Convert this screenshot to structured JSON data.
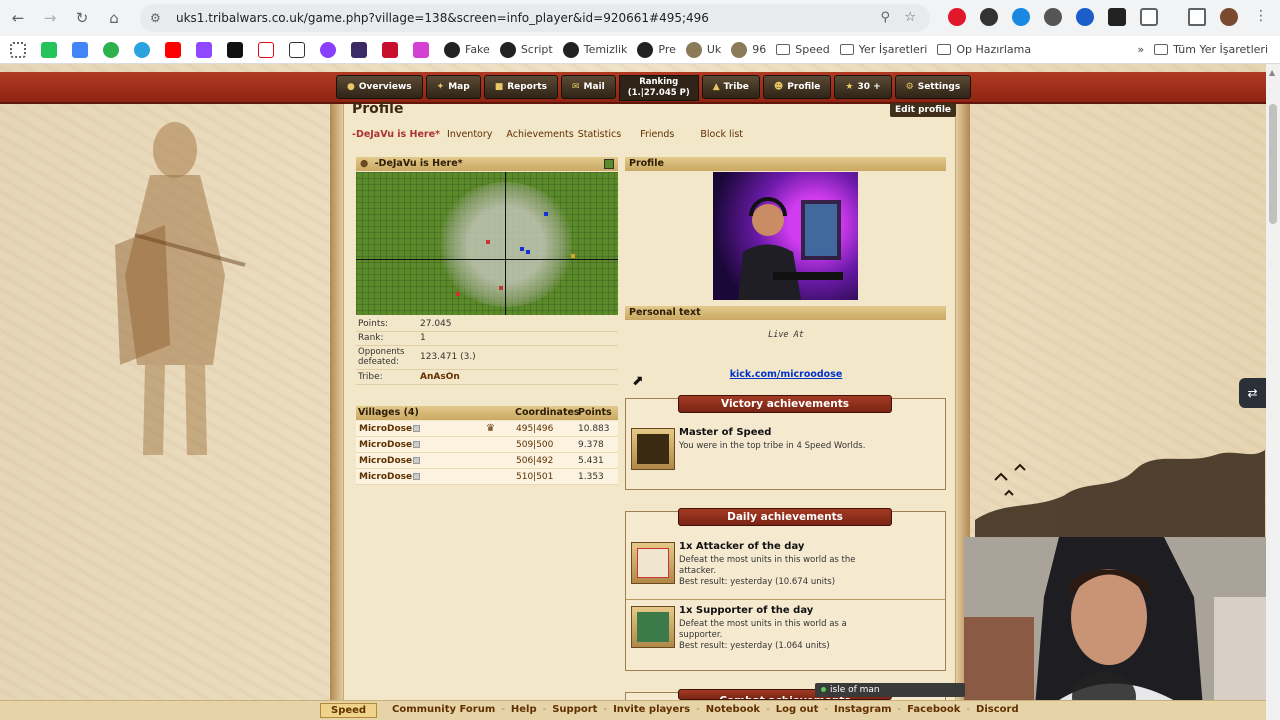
{
  "browser": {
    "url": "uks1.tribalwars.co.uk/game.php?village=138&screen=info_player&id=920661#495;496",
    "bookmarks": [
      "Fake",
      "Script",
      "Temizlik",
      "Pre",
      "Uk",
      "96",
      "Speed",
      "Yer İşaretleri",
      "Op Hazırlama"
    ],
    "all_bookmarks": "Tüm Yer İşaretleri"
  },
  "nav": {
    "buttons": [
      "Overviews",
      "Map",
      "Reports",
      "Mail",
      "Tribe",
      "Profile",
      "30 +",
      "Settings"
    ],
    "ranking_label": "Ranking",
    "ranking_value": "(1.|27.045 P)"
  },
  "profile": {
    "title": "Profile",
    "edit_label": "Edit profile",
    "tabs": [
      "-DeJaVu is Here*",
      "Inventory",
      "Achievements",
      "Statistics",
      "Friends",
      "Block list"
    ],
    "player_name": "-DeJaVu is Here*",
    "stats": [
      {
        "label": "Points:",
        "value": "27.045"
      },
      {
        "label": "Rank:",
        "value": "1"
      },
      {
        "label": "Opponents defeated:",
        "value": "123.471 (3.)"
      },
      {
        "label": "Tribe:",
        "value": "AnAsOn"
      }
    ],
    "villages_header": {
      "name": "Villages (4)",
      "coords": "Coordinates",
      "points": "Points"
    },
    "villages": [
      {
        "name": "MicroDose",
        "coords": "495|496",
        "points": "10.883"
      },
      {
        "name": "MicroDose",
        "coords": "509|500",
        "points": "9.378"
      },
      {
        "name": "MicroDose",
        "coords": "506|492",
        "points": "5.431"
      },
      {
        "name": "MicroDose",
        "coords": "510|501",
        "points": "1.353"
      }
    ],
    "profile_header": "Profile",
    "personal_text_header": "Personal text",
    "personal_text": "Live At",
    "link": "kick.com/microodose"
  },
  "achievements": {
    "victory_title": "Victory achievements",
    "victory": {
      "name": "Master of Speed",
      "desc": "You were in the top tribe in 4 Speed Worlds."
    },
    "daily_title": "Daily achievements",
    "daily": [
      {
        "name": "1x Attacker of the day",
        "desc": "Defeat the most units in this world as the attacker.",
        "best": "Best result: yesterday (10.674 units)"
      },
      {
        "name": "1x Supporter of the day",
        "desc": "Defeat the most units in this world as a supporter.",
        "best": "Best result: yesterday (1.064 units)"
      }
    ],
    "combat_title": "Combat achievements"
  },
  "footer": {
    "speed": "Speed",
    "links": [
      "Community Forum",
      "Help",
      "Support",
      "Invite players",
      "Notebook",
      "Log out",
      "Instagram",
      "Facebook",
      "Discord"
    ]
  },
  "chat_popup": "isle of man",
  "colors": {
    "accent_red": "#8e2413",
    "link_brown": "#603000",
    "link_blue": "#0033cc"
  }
}
